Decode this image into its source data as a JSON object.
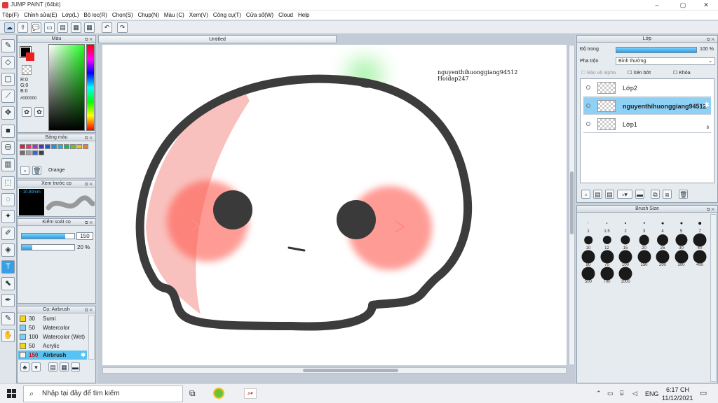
{
  "window": {
    "title": "JUMP PAINT (64bit)",
    "min_glyph": "–",
    "max_glyph": "▢",
    "close_glyph": "✕"
  },
  "menu": [
    "Tệp(F)",
    "Chỉnh sửa(E)",
    "Lớp(L)",
    "Bộ lọc(R)",
    "Chọn(S)",
    "Chụp(N)",
    "Màu (C)",
    "Xem(V)",
    "Công cụ(T)",
    "Cửa sổ(W)",
    "Cloud",
    "Help"
  ],
  "toolbar": {
    "icons": [
      "cloud-icon",
      "share-icon",
      "comment-icon",
      "message-icon",
      "page-icon",
      "page-grid-icon",
      "grid-icon",
      "undo-icon",
      "redo-icon"
    ],
    "glyphs": [
      "☁",
      "⇪",
      "💬",
      "▭",
      "▤",
      "▦",
      "▦",
      "↶",
      "↷"
    ]
  },
  "color_panel": {
    "title": "Màu",
    "r": "R:0",
    "g": "G:0",
    "b": "B:0",
    "hex": "#000000",
    "foreground": "#000000",
    "background": "#e82020"
  },
  "palette_panel": {
    "title": "Bảng màu",
    "selected_name": "Orange",
    "colors_row1": [
      "#e6194b",
      "#f0307d",
      "#b030c0",
      "#5030d0",
      "#2050e0",
      "#2090f0",
      "#20b8c8",
      "#20b070",
      "#70c020",
      "#f0c020",
      "#f08020"
    ],
    "colors_row2": [
      "#707070",
      "#a0a0a0",
      "#3a6ad0",
      "#404040"
    ]
  },
  "brush_preview": {
    "title": "Xem trước cọ",
    "size_label": "10.89mm"
  },
  "brush_control": {
    "title": "Kiểm soát cọ",
    "size_value": "150",
    "opacity_value": "20 %",
    "size_fraction": 0.82,
    "opacity_fraction": 0.2
  },
  "brush_list": {
    "title": "Cọ: Airbrush",
    "items": [
      {
        "size": "30",
        "name": "Sumi",
        "color": "#f5d51a"
      },
      {
        "size": "50",
        "name": "Watercolor",
        "color": "#7ad0f5"
      },
      {
        "size": "100",
        "name": "Watercolor (Wet)",
        "color": "#7ad0f5"
      },
      {
        "size": "50",
        "name": "Acrylic",
        "color": "#f5d51a"
      },
      {
        "size": "150",
        "name": "Airbrush",
        "color": "#f5f5f5"
      }
    ]
  },
  "document": {
    "tab_title": "Untitled",
    "canvas_text_1": "nguyenthihuonggiang94512",
    "canvas_text_2": "Hoidap247"
  },
  "layer_panel": {
    "title": "Lớp",
    "opacity_label": "Độ trong",
    "opacity_value": "100 %",
    "opacity_fraction": 1.0,
    "blend_label": "Pha trộn",
    "blend_value": "Bình thường",
    "protect_alpha": "Bảo vệ alpha",
    "clipping": "Xén bớt",
    "lock": "Khóa",
    "layers": [
      {
        "name": "Lớp2",
        "selected": false
      },
      {
        "name": "nguyenthihuonggiang94512",
        "selected": true
      },
      {
        "name": "Lớp1",
        "selected": false
      }
    ],
    "layer_count_badge": "8"
  },
  "brush_size_panel": {
    "title": "Brush Size",
    "sizes": [
      "1",
      "1.5",
      "2",
      "3",
      "4",
      "5",
      "7",
      "10",
      "12",
      "15",
      "20",
      "25",
      "30",
      "40",
      "50",
      "70",
      "100",
      "150",
      "200",
      "300",
      "400",
      "500",
      "700",
      "1000"
    ]
  },
  "taskbar": {
    "search_placeholder": "Nhập tại đây để tìm kiếm",
    "language": "ENG",
    "time": "6:17 CH",
    "date": "11/12/2021"
  }
}
